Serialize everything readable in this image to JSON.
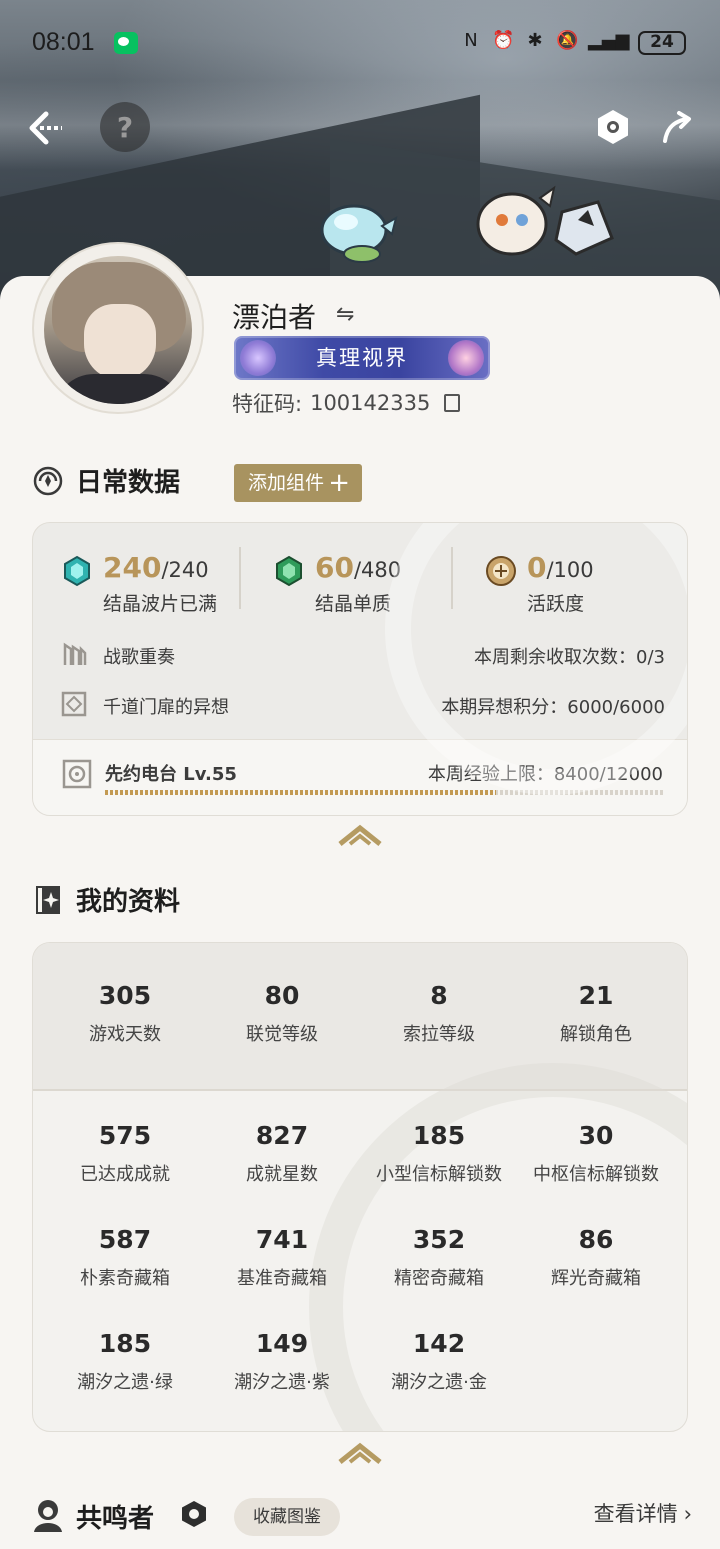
{
  "status_bar": {
    "time": "08:01",
    "battery": "24"
  },
  "profile": {
    "username": "漂泊者",
    "title_badge": "真理视界",
    "uid_label": "特征码:",
    "uid_value": "100142335"
  },
  "daily": {
    "section_title": "日常数据",
    "add_widget_label": "添加组件",
    "stats": [
      {
        "value": "240",
        "max": "/240",
        "label": "结晶波片已满"
      },
      {
        "value": "60",
        "max": "/480",
        "label": "结晶单质"
      },
      {
        "value": "0",
        "max": "/100",
        "label": "活跃度"
      }
    ],
    "rows": [
      {
        "name": "战歌重奏",
        "right": "本周剩余收取次数：0/3"
      },
      {
        "name": "千道门扉的异想",
        "right": "本期异想积分：6000/6000"
      }
    ],
    "radio": {
      "name": "先约电台 Lv.55",
      "right": "本周经验上限：8400/12000",
      "progress": 0.7
    }
  },
  "my_info": {
    "section_title": "我的资料",
    "top_stats": [
      {
        "value": "305",
        "label": "游戏天数"
      },
      {
        "value": "80",
        "label": "联觉等级"
      },
      {
        "value": "8",
        "label": "索拉等级"
      },
      {
        "value": "21",
        "label": "解锁角色"
      }
    ],
    "grid_stats": [
      {
        "value": "575",
        "label": "已达成成就"
      },
      {
        "value": "827",
        "label": "成就星数"
      },
      {
        "value": "185",
        "label": "小型信标解锁数"
      },
      {
        "value": "30",
        "label": "中枢信标解锁数"
      },
      {
        "value": "587",
        "label": "朴素奇藏箱"
      },
      {
        "value": "741",
        "label": "基准奇藏箱"
      },
      {
        "value": "352",
        "label": "精密奇藏箱"
      },
      {
        "value": "86",
        "label": "辉光奇藏箱"
      },
      {
        "value": "185",
        "label": "潮汐之遗·绿"
      },
      {
        "value": "149",
        "label": "潮汐之遗·紫"
      },
      {
        "value": "142",
        "label": "潮汐之遗·金"
      }
    ]
  },
  "resonators": {
    "section_title": "共鸣者",
    "collection_label": "收藏图鉴",
    "details_label": "查看详情"
  },
  "icons": {
    "back": "back-arrow-icon",
    "help": "question-icon",
    "settings": "hexagon-settings-icon",
    "share": "share-arrow-icon"
  },
  "colors": {
    "accent_gold": "#b8955a",
    "badge_blue": "#3f4aa6",
    "add_widget_bg": "#a89360"
  }
}
